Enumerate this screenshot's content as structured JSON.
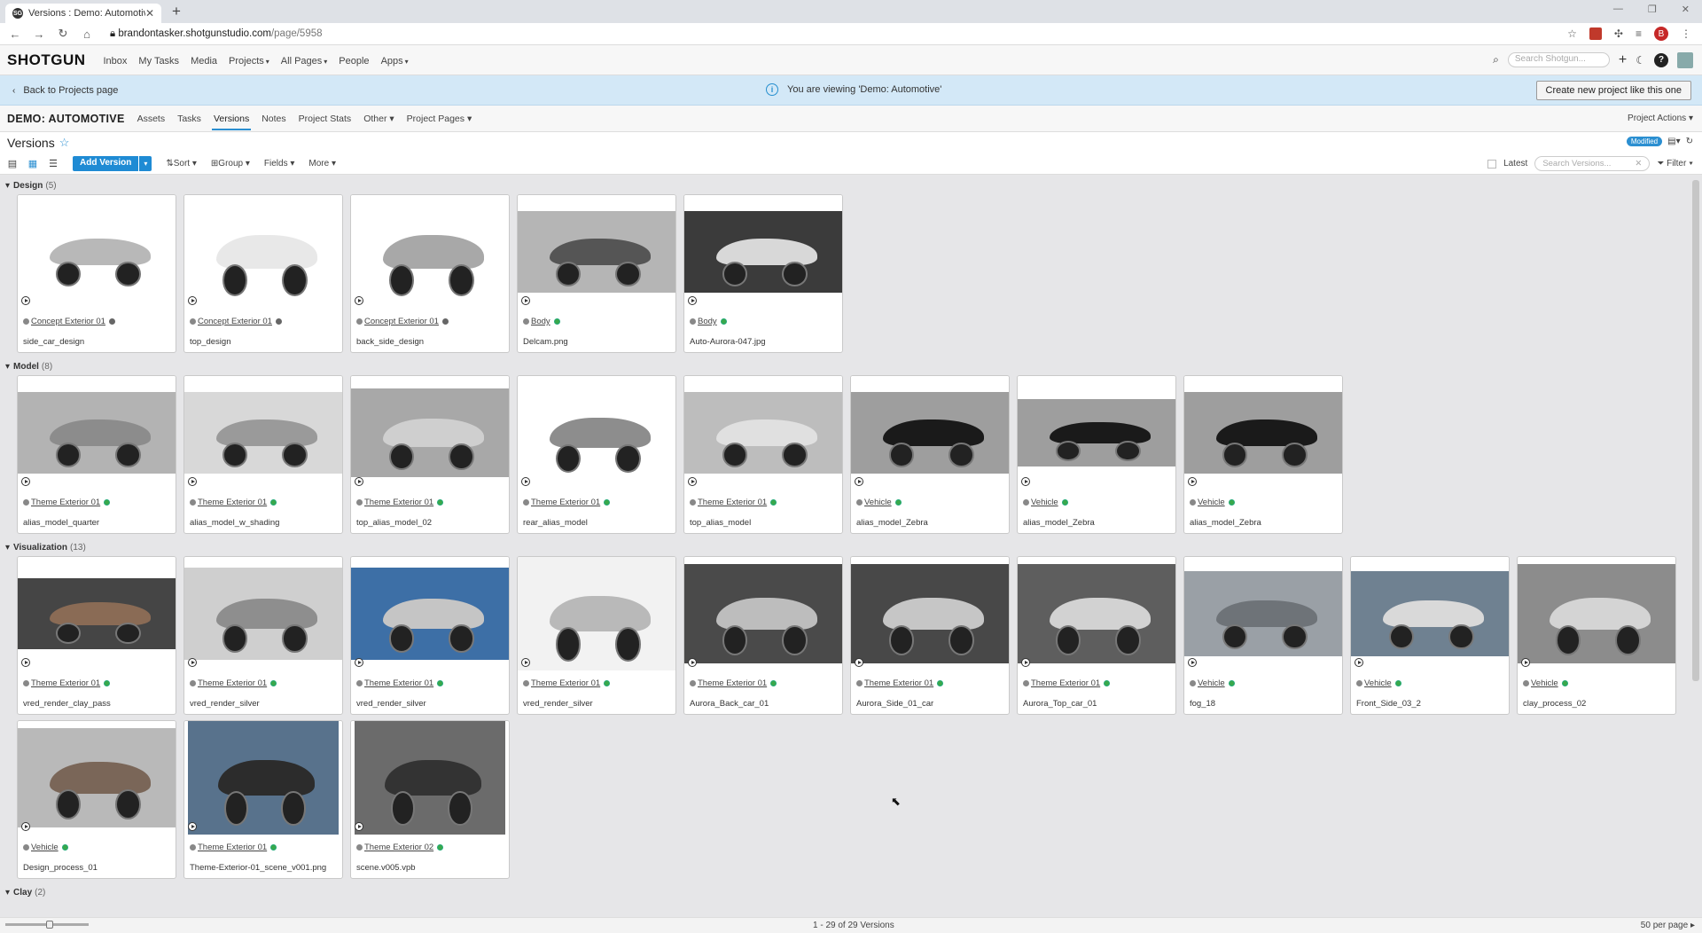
{
  "browser": {
    "tab_title": "Versions : Demo: Automotive",
    "url_host": "brandontasker.shotgunstudio.com",
    "url_path": "/page/5958"
  },
  "nav": {
    "logo": "SHOTGUN",
    "items": [
      {
        "label": "Inbox"
      },
      {
        "label": "My Tasks"
      },
      {
        "label": "Media"
      },
      {
        "label": "Projects",
        "dd": true
      },
      {
        "label": "All Pages",
        "dd": true
      },
      {
        "label": "People"
      },
      {
        "label": "Apps",
        "dd": true
      }
    ],
    "search_placeholder": "Search Shotgun..."
  },
  "banner": {
    "back_label": "Back to Projects page",
    "message": "You are viewing 'Demo: Automotive'",
    "create_label": "Create new project like this one"
  },
  "project": {
    "name": "DEMO: AUTOMOTIVE",
    "tabs": [
      "Assets",
      "Tasks",
      "Versions",
      "Notes",
      "Project Stats",
      "Other",
      "Project Pages"
    ],
    "active_tab": "Versions",
    "actions_label": "Project Actions"
  },
  "page": {
    "title": "Versions",
    "modified_label": "Modified"
  },
  "toolbar": {
    "add_label": "Add Version",
    "sort_label": "Sort",
    "group_label": "Group",
    "fields_label": "Fields",
    "more_label": "More",
    "latest_label": "Latest",
    "search_placeholder": "Search Versions...",
    "filter_label": "Filter"
  },
  "groups": [
    {
      "name": "Design",
      "count": "(5)",
      "items": [
        {
          "link": "Concept Exterior 01",
          "status": "gray",
          "name": "side_car_design",
          "bg": "#ffffff",
          "car": "#b8b8b8",
          "h": 92
        },
        {
          "link": "Concept Exterior 01",
          "status": "gray",
          "name": "top_design",
          "bg": "#ffffff",
          "car": "#e8e8e8",
          "h": 120
        },
        {
          "link": "Concept Exterior 01",
          "status": "gray",
          "name": "back_side_design",
          "bg": "#ffffff",
          "car": "#a8a8a8",
          "h": 120
        },
        {
          "link": "Body",
          "status": "green",
          "name": "Delcam.png",
          "bg": "#b5b5b5",
          "car": "#555555",
          "h": 92
        },
        {
          "link": "Body",
          "status": "green",
          "name": "Auto-Aurora-047.jpg",
          "bg": "#3b3b3b",
          "car": "#d8d8d8",
          "h": 92
        }
      ]
    },
    {
      "name": "Model",
      "count": "(8)",
      "items": [
        {
          "link": "Theme Exterior 01",
          "status": "green",
          "name": "alias_model_quarter",
          "bg": "#b3b3b3",
          "car": "#8c8c8c",
          "h": 92
        },
        {
          "link": "Theme Exterior 01",
          "status": "green",
          "name": "alias_model_w_shading",
          "bg": "#d8d8d8",
          "car": "#9a9a9a",
          "h": 92
        },
        {
          "link": "Theme Exterior 01",
          "status": "green",
          "name": "top_alias_model_02",
          "bg": "#a8a8a8",
          "car": "#cfcfcf",
          "h": 100
        },
        {
          "link": "Theme Exterior 01",
          "status": "green",
          "name": "rear_alias_model",
          "bg": "#ffffff",
          "car": "#8d8d8d",
          "h": 108
        },
        {
          "link": "Theme Exterior 01",
          "status": "green",
          "name": "top_alias_model",
          "bg": "#bdbdbd",
          "car": "#e0e0e0",
          "h": 92
        },
        {
          "link": "Vehicle",
          "status": "green",
          "name": "alias_model_Zebra",
          "bg": "#9e9e9e",
          "car": "#1a1a1a",
          "h": 92
        },
        {
          "link": "Vehicle",
          "status": "green",
          "name": "alias_model_Zebra",
          "bg": "#9e9e9e",
          "car": "#1a1a1a",
          "h": 76
        },
        {
          "link": "Vehicle",
          "status": "green",
          "name": "alias_model_Zebra",
          "bg": "#9e9e9e",
          "car": "#1a1a1a",
          "h": 92
        }
      ]
    },
    {
      "name": "Visualization",
      "count": "(13)",
      "items": [
        {
          "link": "Theme Exterior 01",
          "status": "green",
          "name": "vred_render_clay_pass",
          "bg": "#454545",
          "car": "#8a6b55",
          "h": 80
        },
        {
          "link": "Theme Exterior 01",
          "status": "green",
          "name": "vred_render_silver",
          "bg": "#cfcfcf",
          "car": "#8e8e8e",
          "h": 104
        },
        {
          "link": "Theme Exterior 01",
          "status": "green",
          "name": "vred_render_silver",
          "bg": "#3d6fa6",
          "car": "#c5c5c5",
          "h": 104
        },
        {
          "link": "Theme Exterior 01",
          "status": "green",
          "name": "vred_render_silver",
          "bg": "#f2f2f2",
          "car": "#b9b9b9",
          "h": 128
        },
        {
          "link": "Theme Exterior 01",
          "status": "green",
          "name": "Aurora_Back_car_01",
          "bg": "#4a4a4a",
          "car": "#bdbdbd",
          "h": 112
        },
        {
          "link": "Theme Exterior 01",
          "status": "green",
          "name": "Aurora_Side_01_car",
          "bg": "#484848",
          "car": "#c6c6c6",
          "h": 112
        },
        {
          "link": "Theme Exterior 01",
          "status": "green",
          "name": "Aurora_Top_car_01",
          "bg": "#5e5e5e",
          "car": "#d2d2d2",
          "h": 112
        },
        {
          "link": "Vehicle",
          "status": "green",
          "name": "fog_18",
          "bg": "#9aa0a6",
          "car": "#6e7378",
          "h": 96
        },
        {
          "link": "Vehicle",
          "status": "green",
          "name": "Front_Side_03_2",
          "bg": "#6f8191",
          "car": "#d9d9d9",
          "h": 96
        },
        {
          "link": "Vehicle",
          "status": "green",
          "name": "clay_process_02",
          "bg": "#8c8c8c",
          "car": "#d4d4d4",
          "h": 112
        },
        {
          "link": "Vehicle",
          "status": "green",
          "name": "Design_process_01",
          "bg": "#b9b9b9",
          "car": "#7a6658",
          "h": 112
        },
        {
          "link": "Theme Exterior 01",
          "status": "green",
          "name": "Theme-Exterior-01_scene_v001.png",
          "bg": "#58728c",
          "car": "#2c2c2c",
          "h": 128,
          "w": 170
        },
        {
          "link": "Theme Exterior 02",
          "status": "green",
          "name": "scene.v005.vpb",
          "bg": "#6b6b6b",
          "car": "#333333",
          "h": 128,
          "w": 170
        }
      ]
    },
    {
      "name": "Clay",
      "count": "(2)",
      "items": []
    }
  ],
  "status": {
    "count_text": "1 - 29 of 29 Versions",
    "per_page": "50 per page"
  }
}
